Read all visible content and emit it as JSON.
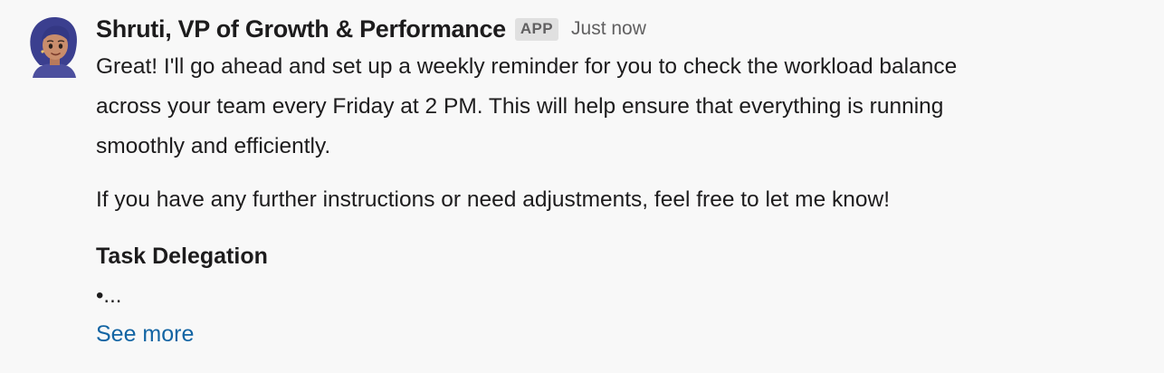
{
  "message": {
    "sender": "Shruti, VP of Growth & Performance",
    "badge": "APP",
    "timestamp": "Just now",
    "paragraph1_lines": [
      "Great! I'll go ahead and set up a weekly reminder for you to check the workload balance",
      "across your team every Friday at 2 PM. This will help ensure that everything is running",
      "smoothly and efficiently."
    ],
    "paragraph2": "If you have any further instructions or need adjustments, feel free to let me know!",
    "section_title": "Task Delegation",
    "bullet": "•...",
    "see_more": "See more"
  },
  "avatar": {
    "icon": "illustrated-woman-avatar",
    "background": "#ffffff",
    "hair_color": "#3b3f8f",
    "skin_color": "#c98d6c",
    "shirt_color": "#4c4f9e"
  },
  "colors": {
    "link": "#1264a3",
    "muted": "#616061",
    "text": "#1d1c1d",
    "badge_bg": "#e0e0e0"
  }
}
